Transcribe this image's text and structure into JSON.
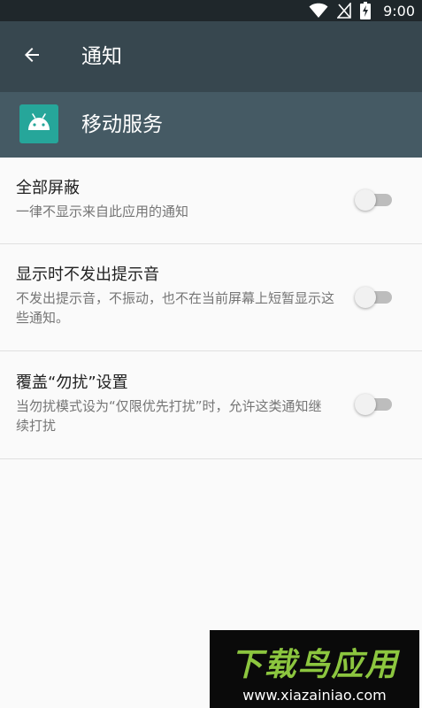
{
  "status_bar": {
    "time": "9:00",
    "icons": [
      "wifi-icon",
      "no-sim-icon",
      "battery-charging-icon"
    ]
  },
  "toolbar": {
    "back_icon": "arrow-back-icon",
    "title": "通知"
  },
  "app_header": {
    "icon": "android-icon",
    "icon_color": "#26a69a",
    "name": "移动服务"
  },
  "settings": [
    {
      "title": "全部屏蔽",
      "description": "一律不显示来自此应用的通知",
      "enabled": false
    },
    {
      "title": "显示时不发出提示音",
      "description": "不发出提示音，不振动，也不在当前屏幕上短暂显示这些通知。",
      "enabled": false
    },
    {
      "title": "覆盖“勿扰”设置",
      "description": "当勿扰模式设为“仅限优先打扰”时，允许这类通知继续打扰",
      "enabled": false
    }
  ],
  "watermark": {
    "logo_text": "下载鸟应用",
    "url": "www.xiazainiao.com"
  },
  "colors": {
    "status_bar": "#1f272b",
    "toolbar": "#37474f",
    "app_header": "#455a64",
    "background": "#fafafa"
  }
}
